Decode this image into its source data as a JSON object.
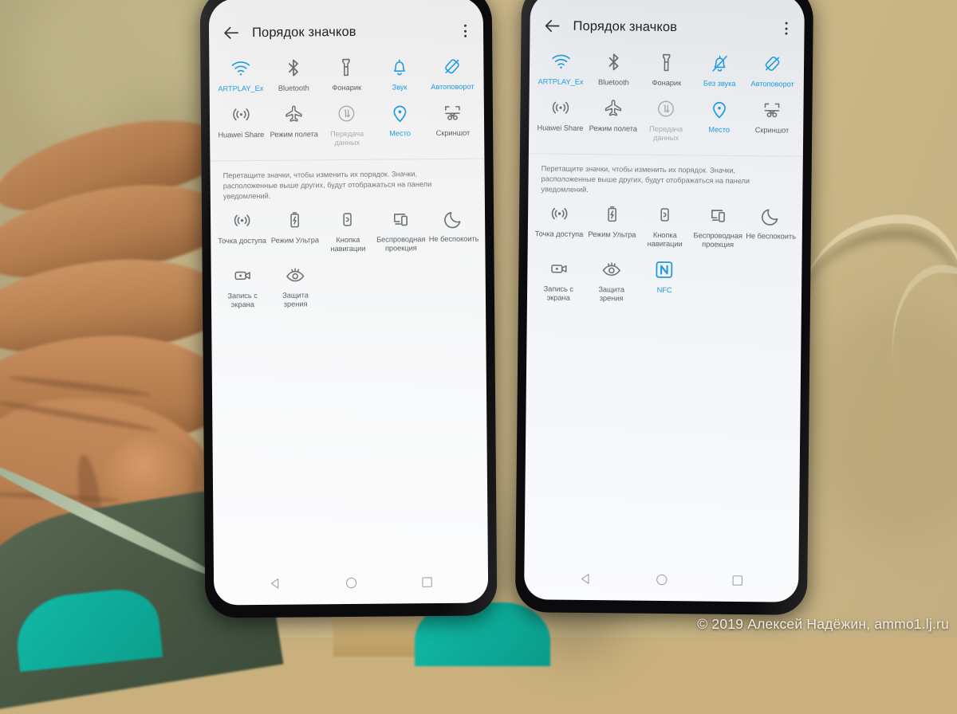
{
  "photo": {
    "watermark": "© 2019 Алексей Надёжин, ammo1.lj.ru",
    "accent_color": "#1f9ae0",
    "label_color": "#5b6165",
    "dim_color": "#a9aeb2",
    "screen_color": "#f7f8f9",
    "bezel_color": "#0b0b0d"
  },
  "phones": [
    {
      "id": "left",
      "appbar": {
        "title": "Порядок значков",
        "back_icon": "back-arrow-icon",
        "menu_icon": "overflow-menu-icon"
      },
      "hint": "Перетащите значки, чтобы изменить их порядок. Значки, расположенные выше других, будут отображаться на панели уведомлений.",
      "top_tiles": [
        {
          "label": "ARTPLAY_Ex",
          "icon": "wifi-icon",
          "state": "on"
        },
        {
          "label": "Bluetooth",
          "icon": "bluetooth-icon",
          "state": "off"
        },
        {
          "label": "Фонарик",
          "icon": "flashlight-icon",
          "state": "off"
        },
        {
          "label": "Звук",
          "icon": "bell-icon",
          "state": "on"
        },
        {
          "label": "Автоповорот",
          "icon": "auto-rotate-icon",
          "state": "on"
        },
        {
          "label": "Huawei Share",
          "icon": "huawei-share-icon",
          "state": "off"
        },
        {
          "label": "Режим полета",
          "icon": "airplane-icon",
          "state": "off"
        },
        {
          "label": "Передача данных",
          "icon": "data-transfer-icon",
          "state": "dim"
        },
        {
          "label": "Место",
          "icon": "location-pin-icon",
          "state": "on"
        },
        {
          "label": "Скриншот",
          "icon": "screenshot-icon",
          "state": "off"
        }
      ],
      "bottom_tiles": [
        {
          "label": "Точка доступа",
          "icon": "hotspot-icon",
          "state": "off"
        },
        {
          "label": "Режим Ультра",
          "icon": "ultra-battery-icon",
          "state": "off"
        },
        {
          "label": "Кнопка навигации",
          "icon": "nav-button-icon",
          "state": "off"
        },
        {
          "label": "Беспроводная проекция",
          "icon": "cast-screen-icon",
          "state": "off"
        },
        {
          "label": "Не беспокоить",
          "icon": "moon-icon",
          "state": "off"
        },
        {
          "label": "Запись с экрана",
          "icon": "screen-record-icon",
          "state": "off"
        },
        {
          "label": "Защита зрения",
          "icon": "eye-comfort-icon",
          "state": "off"
        }
      ],
      "navbar": [
        {
          "icon": "nav-back-triangle-icon"
        },
        {
          "icon": "nav-home-circle-icon"
        },
        {
          "icon": "nav-recents-square-icon"
        }
      ]
    },
    {
      "id": "right",
      "appbar": {
        "title": "Порядок значков",
        "back_icon": "back-arrow-icon",
        "menu_icon": "overflow-menu-icon"
      },
      "hint": "Перетащите значки, чтобы изменить их порядок. Значки, расположенные выше других, будут отображаться на панели уведомлений.",
      "top_tiles": [
        {
          "label": "ARTPLAY_Ex",
          "icon": "wifi-icon",
          "state": "on"
        },
        {
          "label": "Bluetooth",
          "icon": "bluetooth-icon",
          "state": "off"
        },
        {
          "label": "Фонарик",
          "icon": "flashlight-icon",
          "state": "off"
        },
        {
          "label": "Без звука",
          "icon": "bell-muted-icon",
          "state": "on"
        },
        {
          "label": "Автоповорот",
          "icon": "auto-rotate-icon",
          "state": "on"
        },
        {
          "label": "Huawei Share",
          "icon": "huawei-share-icon",
          "state": "off"
        },
        {
          "label": "Режим полета",
          "icon": "airplane-icon",
          "state": "off"
        },
        {
          "label": "Передача данных",
          "icon": "data-transfer-icon",
          "state": "dim"
        },
        {
          "label": "Место",
          "icon": "location-pin-icon",
          "state": "on"
        },
        {
          "label": "Скриншот",
          "icon": "screenshot-icon",
          "state": "off"
        }
      ],
      "bottom_tiles": [
        {
          "label": "Точка доступа",
          "icon": "hotspot-icon",
          "state": "off"
        },
        {
          "label": "Режим Ультра",
          "icon": "ultra-battery-icon",
          "state": "off"
        },
        {
          "label": "Кнопка навигации",
          "icon": "nav-button-icon",
          "state": "off"
        },
        {
          "label": "Беспроводная проекция",
          "icon": "cast-screen-icon",
          "state": "off"
        },
        {
          "label": "Не беспокоить",
          "icon": "moon-icon",
          "state": "off"
        },
        {
          "label": "Запись с экрана",
          "icon": "screen-record-icon",
          "state": "off"
        },
        {
          "label": "Защита зрения",
          "icon": "eye-comfort-icon",
          "state": "off"
        },
        {
          "label": "NFC",
          "icon": "nfc-icon",
          "state": "on"
        }
      ],
      "navbar": [
        {
          "icon": "nav-back-triangle-icon"
        },
        {
          "icon": "nav-home-circle-icon"
        },
        {
          "icon": "nav-recents-square-icon"
        }
      ]
    }
  ]
}
